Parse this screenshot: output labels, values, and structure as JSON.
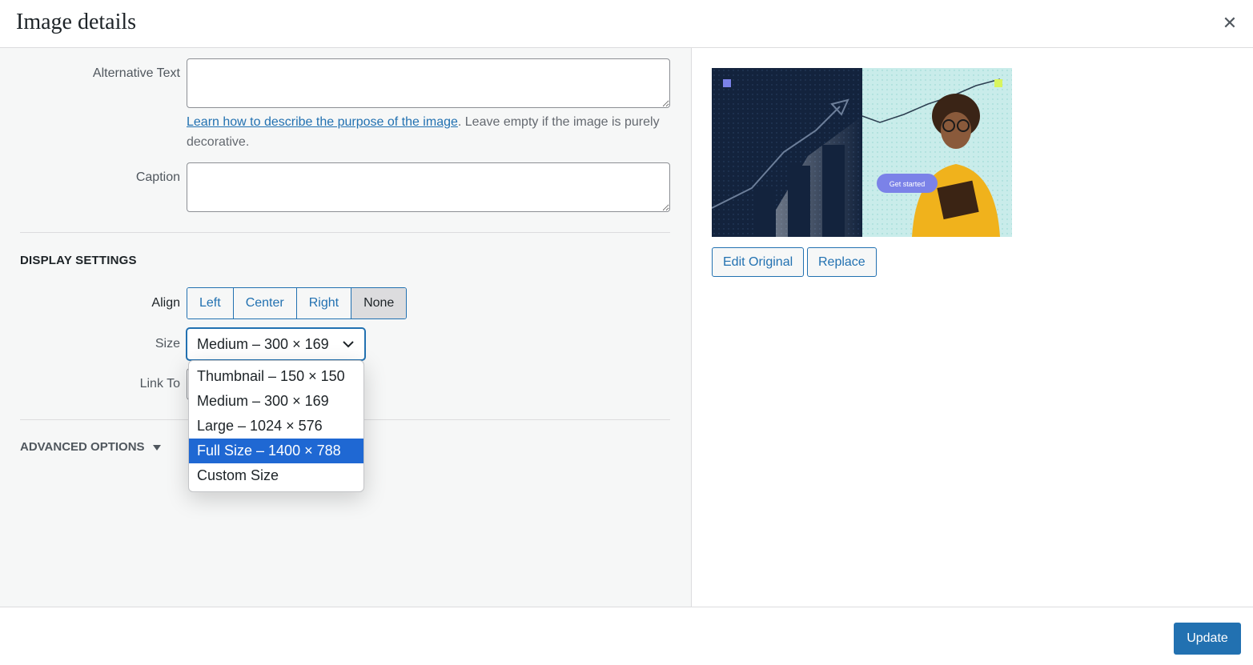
{
  "header": {
    "title": "Image details",
    "close_icon": "close-icon"
  },
  "fields": {
    "alt_label": "Alternative Text",
    "alt_value": "",
    "help_link": "Learn how to describe the purpose of the image",
    "help_rest": ". Leave empty if the image is purely decorative.",
    "caption_label": "Caption",
    "caption_value": ""
  },
  "display": {
    "heading": "Display Settings",
    "align_label": "Align",
    "align_options": [
      "Left",
      "Center",
      "Right",
      "None"
    ],
    "align_selected": "None",
    "size_label": "Size",
    "size_value": "Medium – 300 × 169",
    "size_options": [
      "Thumbnail – 150 × 150",
      "Medium – 300 × 169",
      "Large – 1024 × 576",
      "Full Size – 1400 × 788",
      "Custom Size"
    ],
    "size_highlighted": "Full Size – 1400 × 788",
    "link_label": "Link To"
  },
  "advanced": {
    "label": "Advanced Options"
  },
  "preview": {
    "image_text": "Get started",
    "edit_original": "Edit Original",
    "replace": "Replace"
  },
  "footer": {
    "update": "Update"
  },
  "colors": {
    "accent": "#2271b1",
    "highlight": "#1f68d3",
    "panel_bg": "#f6f7f7"
  }
}
